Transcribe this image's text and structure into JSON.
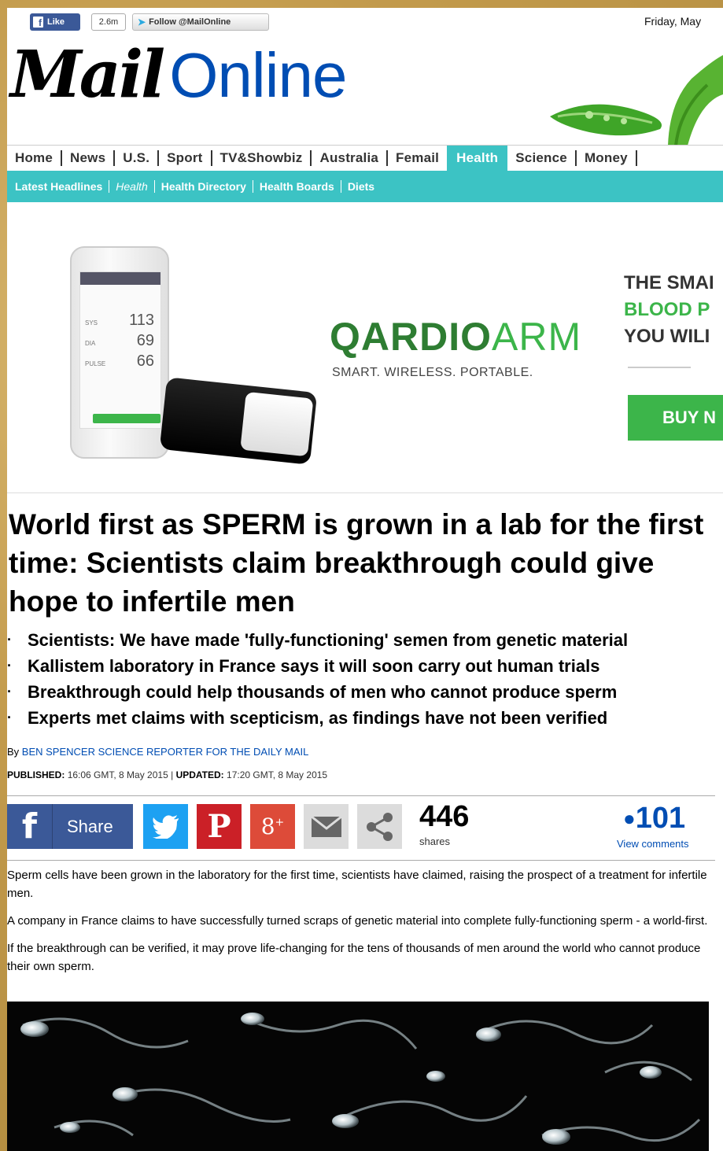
{
  "topbar": {
    "like_label": "Like",
    "like_count": "2.6m",
    "follow_label": "Follow @MailOnline",
    "date": "Friday, May"
  },
  "logo": {
    "mail": "Mail",
    "online": "Online"
  },
  "nav": {
    "items": [
      "Home",
      "News",
      "U.S.",
      "Sport",
      "TV&Showbiz",
      "Australia",
      "Femail",
      "Health",
      "Science",
      "Money"
    ],
    "active": "Health"
  },
  "subnav": {
    "items": [
      "Latest Headlines",
      "Health",
      "Health Directory",
      "Health Boards",
      "Diets"
    ]
  },
  "ad": {
    "phone_readings": [
      {
        "label": "SYS",
        "value": "113"
      },
      {
        "label": "DIA",
        "value": "69"
      },
      {
        "label": "PULSE",
        "value": "66"
      }
    ],
    "brand_q": "QARDIO",
    "brand_arm": "ARM",
    "tagline": "SMART. WIRELESS. PORTABLE.",
    "right_line1": "THE SMAI",
    "right_line2": "BLOOD P",
    "right_line3": "YOU WILI",
    "buy_label": "BUY N",
    "accent_color": "#3cb54a"
  },
  "article": {
    "headline": "World first as SPERM is grown in a lab for the first time: Scientists claim breakthrough could give hope to infertile men",
    "bullets": [
      "Scientists: We have made 'fully-functioning' semen from genetic material",
      "Kallistem laboratory in France says it will soon carry out human trials",
      "Breakthrough could help thousands of men who cannot produce sperm",
      "Experts met claims with scepticism, as findings have not been verified"
    ],
    "byline_prefix": "By",
    "byline": "BEN SPENCER SCIENCE REPORTER FOR THE DAILY MAIL",
    "published_label": "PUBLISHED:",
    "published": "16:06 GMT, 8 May 2015",
    "updated_label": "UPDATED:",
    "updated": "17:20 GMT, 8 May 2015",
    "paragraphs": [
      "Sperm cells have been grown in the laboratory for the first time, scientists have claimed, raising the prospect of a treatment for infertile men.",
      "A company in France claims to have successfully turned scraps of genetic material into complete fully-functioning sperm - a world-first.",
      "If the breakthrough can be verified, it may prove life-changing for the tens of thousands of men around the world who cannot produce their own sperm."
    ]
  },
  "share": {
    "share_label": "Share",
    "share_count": "446",
    "shares_label": "shares",
    "comments_count": "101",
    "comments_label": "View comments"
  },
  "colors": {
    "nav_accent": "#3cc3c4",
    "link_blue": "#004db3",
    "facebook": "#3b5998",
    "twitter": "#1da1f2",
    "pinterest": "#cb2027",
    "googleplus": "#dd4b39"
  }
}
